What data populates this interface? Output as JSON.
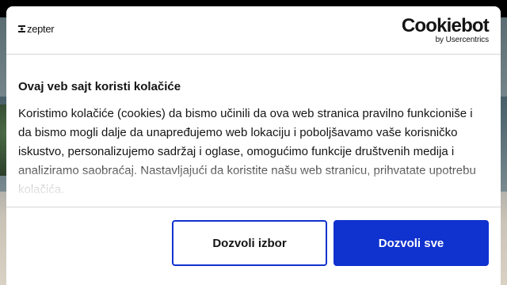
{
  "header": {
    "brand_logo_text": "zepter",
    "provider_logo_text": "Cookiebot",
    "provider_logo_subtext": "by Usercentrics"
  },
  "dialog": {
    "title": "Ovaj veb sajt koristi kolačiće",
    "body": "Koristimo kolačiće (cookies) da bismo učinili da ova web stranica pravilno funkcioniše i da bismo mogli dalje da unapređujemo web lokaciju i poboljšavamo vaše korisničko iskustvo, personalizujemo sadržaj i oglase, omogućimo funkcije društvenih medija i analiziramo saobraćaj. Nastavljajući da koristite našu web stranicu, prihvatate upotrebu kolačića."
  },
  "buttons": {
    "allow_selection": "Dozvoli izbor",
    "allow_all": "Dozvoli sve"
  },
  "colors": {
    "accent": "#1032cf",
    "text": "#141414",
    "divider": "#d6d6d6"
  }
}
